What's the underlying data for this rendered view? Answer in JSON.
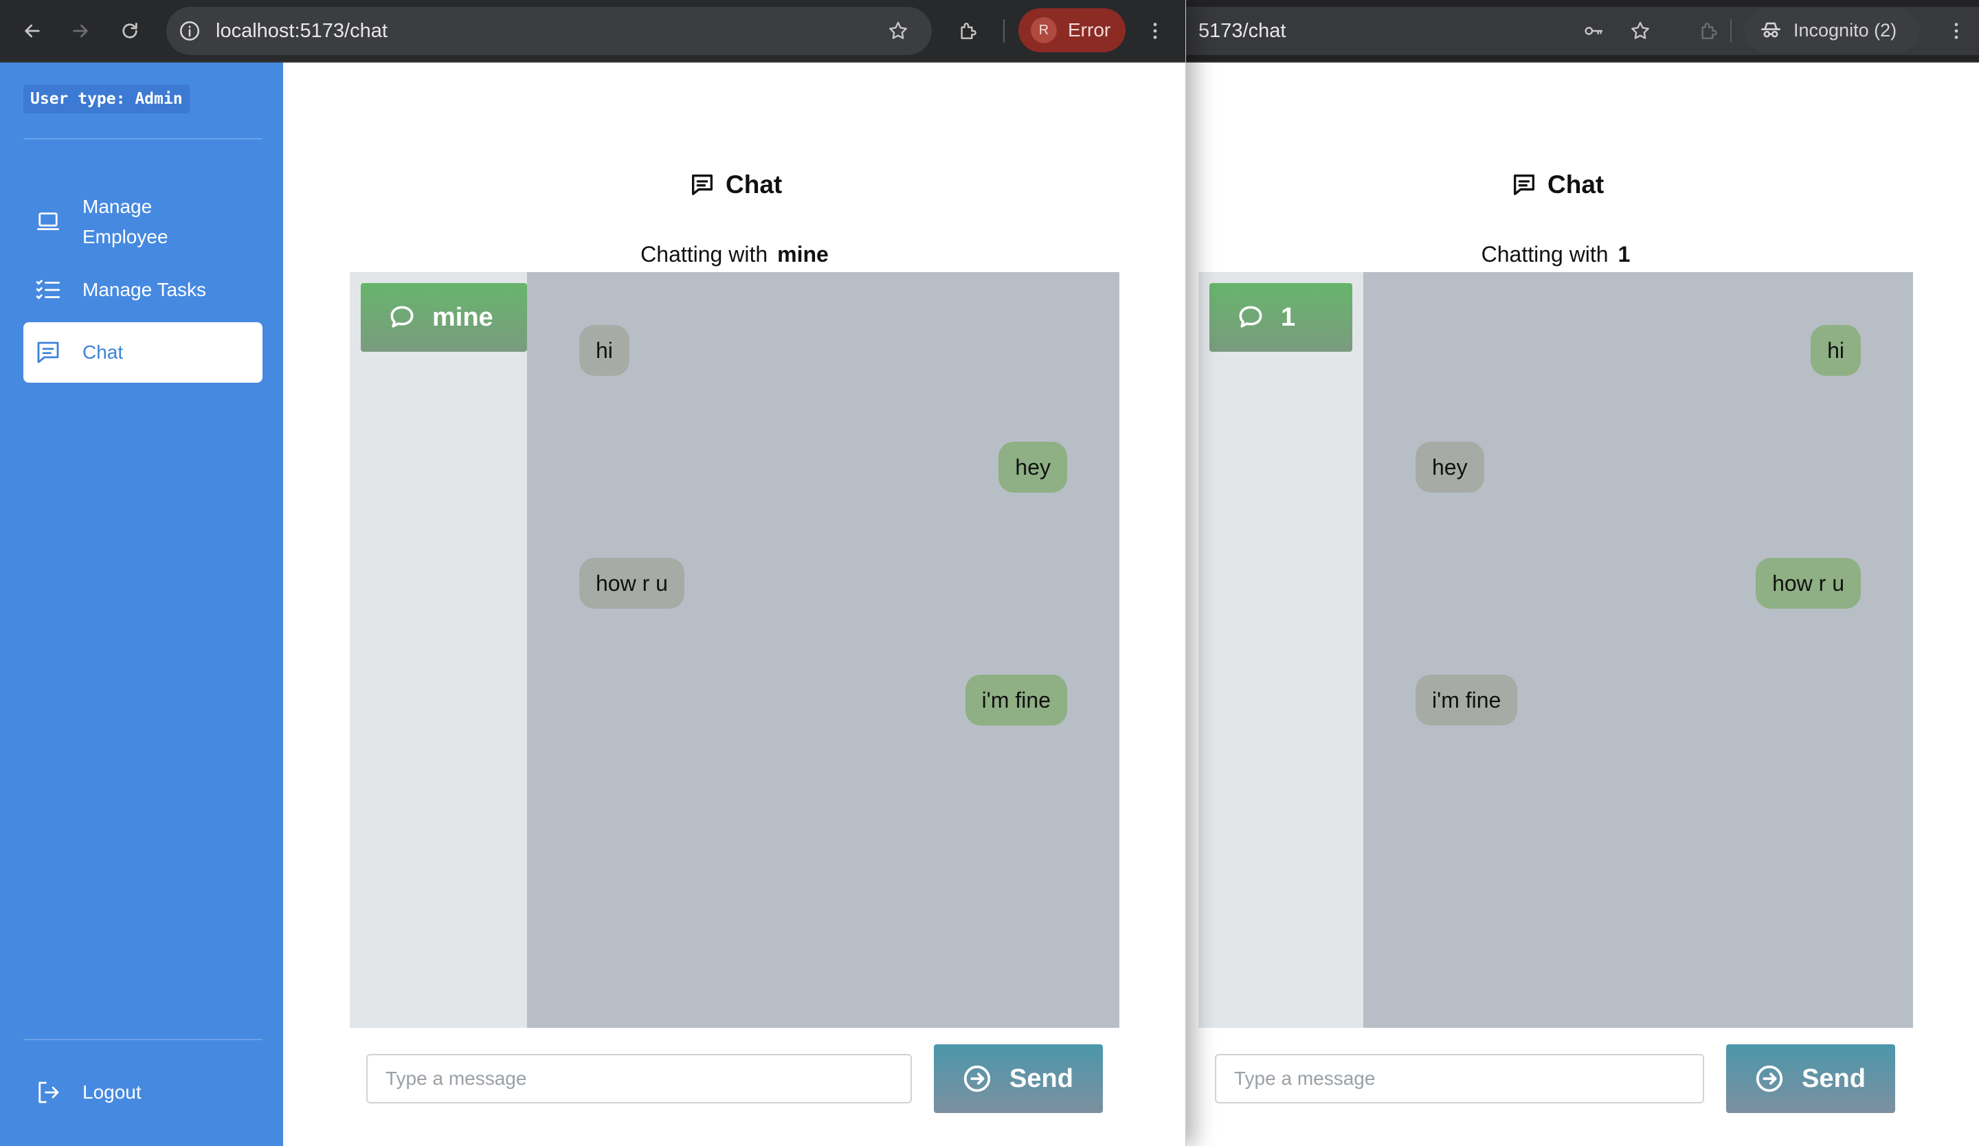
{
  "colors": {
    "sidebar": "#4689e0",
    "contact_button": "#67b56b",
    "send_button": "#4b97ab",
    "incoming_bubble": "#a7aba5",
    "outgoing_bubble": "#8eb084",
    "messages_bg": "#b8bec6",
    "error_pill": "#8c2a24"
  },
  "left_window": {
    "toolbar": {
      "url": "localhost:5173/chat",
      "profile_initial": "R",
      "profile_label": "Error"
    },
    "sidebar": {
      "user_type": "User type: Admin",
      "items": [
        {
          "label": "Manage\nEmployee",
          "icon": "laptop-icon",
          "active": false
        },
        {
          "label": "Manage Tasks",
          "icon": "task-list-icon",
          "active": false
        },
        {
          "label": "Chat",
          "icon": "chat-icon",
          "active": true
        }
      ],
      "logout_label": "Logout"
    },
    "chat": {
      "title": "Chat",
      "chatting_with_prefix": "Chatting with",
      "chatting_with_name": "mine",
      "contacts": [
        {
          "name": "mine",
          "icon": "chat-bubble-icon"
        }
      ],
      "messages": [
        {
          "text": "hi",
          "direction": "incoming"
        },
        {
          "text": "hey",
          "direction": "outgoing"
        },
        {
          "text": "how r u",
          "direction": "incoming"
        },
        {
          "text": "i'm fine",
          "direction": "outgoing"
        }
      ],
      "input_placeholder": "Type a message",
      "send_label": "Send"
    }
  },
  "right_window": {
    "toolbar": {
      "url": "5173/chat",
      "incognito_label": "Incognito (2)"
    },
    "chat": {
      "title": "Chat",
      "chatting_with_prefix": "Chatting with",
      "chatting_with_name": "1",
      "contacts": [
        {
          "name": "1",
          "icon": "chat-bubble-icon"
        }
      ],
      "messages": [
        {
          "text": "hi",
          "direction": "outgoing"
        },
        {
          "text": "hey",
          "direction": "incoming"
        },
        {
          "text": "how r u",
          "direction": "outgoing"
        },
        {
          "text": "i'm fine",
          "direction": "incoming"
        }
      ],
      "input_placeholder": "Type a message",
      "send_label": "Send"
    }
  }
}
